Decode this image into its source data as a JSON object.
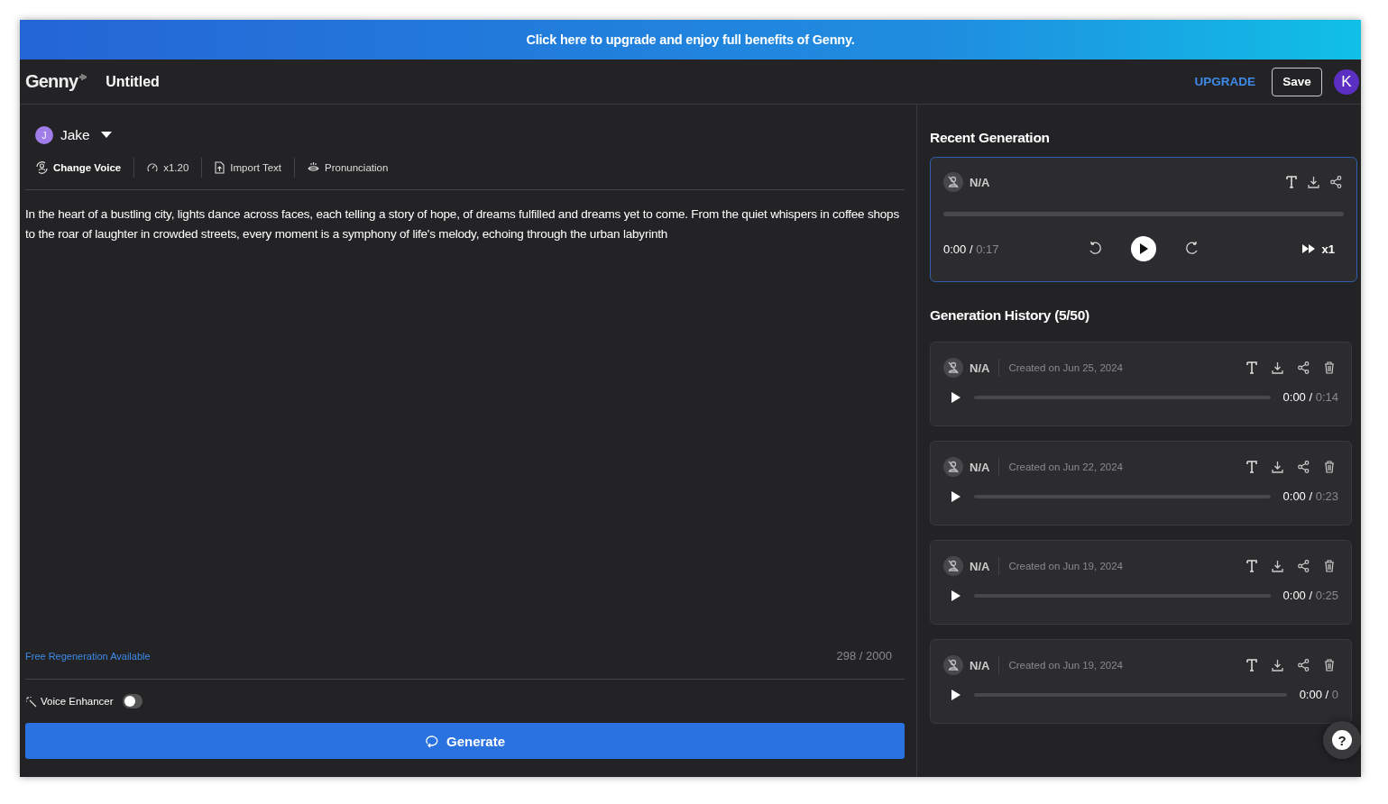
{
  "banner": {
    "text": "Click here to upgrade and enjoy full benefits of Genny."
  },
  "header": {
    "logo": "Genny",
    "title": "Untitled",
    "upgrade": "UPGRADE",
    "save": "Save",
    "avatar": "K"
  },
  "editor": {
    "voice": {
      "initial": "J",
      "name": "Jake"
    },
    "tools": [
      {
        "kind": "voice",
        "label": "Change Voice"
      },
      {
        "kind": "speed",
        "label": "x1.20"
      },
      {
        "kind": "import",
        "label": "Import Text"
      },
      {
        "kind": "pronunciation",
        "label": "Pronunciation"
      }
    ],
    "text": "In the heart of a bustling city, lights dance across faces, each telling a story of hope, of dreams fulfilled and dreams yet to come. From the quiet whispers in coffee shops to the roar of laughter in crowded streets, every moment is a symphony of life's melody, echoing through the urban labyrinth",
    "free_regeneration": "Free Regeneration Available",
    "char_count": "298 / 2000",
    "voice_enhancer": {
      "label": "Voice Enhancer",
      "on": false
    },
    "generate": "Generate"
  },
  "recent": {
    "title": "Recent Generation",
    "voice": "N/A",
    "elapsed": "0:00 /",
    "total": "0:17",
    "speed": "x1"
  },
  "history": {
    "title": "Generation History (5/50)",
    "items": [
      {
        "voice": "N/A",
        "created": "Created on Jun 25, 2024",
        "elapsed": "0:00 /",
        "total": "0:14"
      },
      {
        "voice": "N/A",
        "created": "Created on Jun 22, 2024",
        "elapsed": "0:00 /",
        "total": "0:23"
      },
      {
        "voice": "N/A",
        "created": "Created on Jun 19, 2024",
        "elapsed": "0:00 /",
        "total": "0:25"
      },
      {
        "voice": "N/A",
        "created": "Created on Jun 19, 2024",
        "elapsed": "0:00 /",
        "total": "0"
      }
    ]
  },
  "help": {
    "label": "?"
  }
}
